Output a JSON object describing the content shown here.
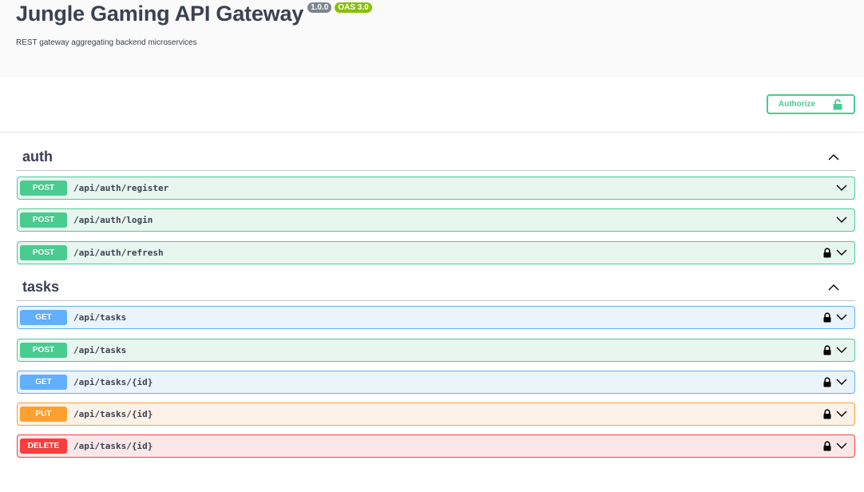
{
  "info": {
    "title": "Jungle Gaming API Gateway",
    "version_badge": "1.0.0",
    "oas_badge": "OAS 3.0",
    "description": "REST gateway aggregating backend microservices"
  },
  "authorize": {
    "label": "Authorize",
    "icon": "unlocked-padlock-icon"
  },
  "tags": [
    {
      "name": "auth",
      "operations": [
        {
          "method": "POST",
          "path": "/api/auth/register",
          "locked": false
        },
        {
          "method": "POST",
          "path": "/api/auth/login",
          "locked": false
        },
        {
          "method": "POST",
          "path": "/api/auth/refresh",
          "locked": true
        }
      ]
    },
    {
      "name": "tasks",
      "operations": [
        {
          "method": "GET",
          "path": "/api/tasks",
          "locked": true
        },
        {
          "method": "POST",
          "path": "/api/tasks",
          "locked": true
        },
        {
          "method": "GET",
          "path": "/api/tasks/{id}",
          "locked": true
        },
        {
          "method": "PUT",
          "path": "/api/tasks/{id}",
          "locked": true
        },
        {
          "method": "DELETE",
          "path": "/api/tasks/{id}",
          "locked": true
        }
      ]
    }
  ],
  "colors": {
    "post": "#49cc90",
    "get": "#61affe",
    "put": "#fca130",
    "delete": "#f93e3e",
    "text": "#3b4151"
  }
}
